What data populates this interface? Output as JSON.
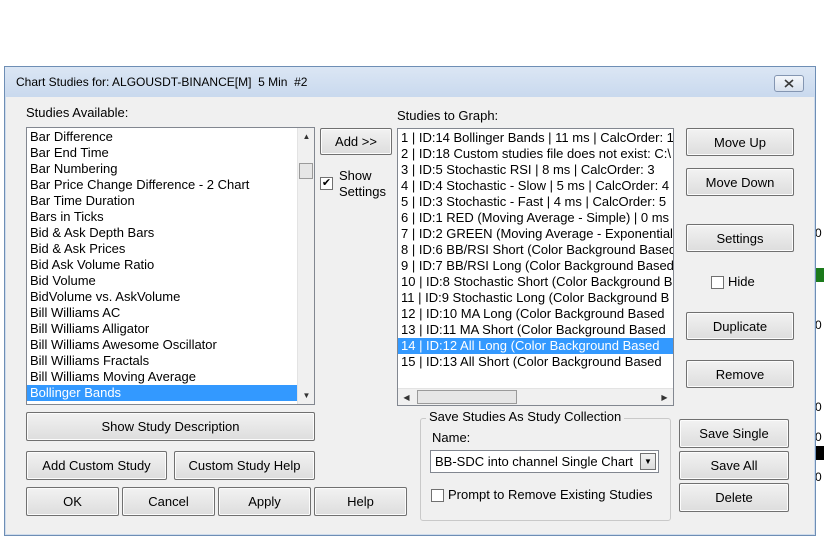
{
  "background_ticks": [
    "0",
    "0",
    "0",
    "0",
    "0"
  ],
  "dialog": {
    "title": "Chart Studies for: ALGOUSDT-BINANCE[M]  5 Min  #2",
    "close_icon": "close-icon"
  },
  "available": {
    "label": "Studies Available:",
    "items": [
      "Bar Difference",
      "Bar End Time",
      "Bar Numbering",
      "Bar Price Change Difference - 2 Chart",
      "Bar Time Duration",
      "Bars in Ticks",
      "Bid & Ask Depth Bars",
      "Bid & Ask Prices",
      "Bid Ask Volume Ratio",
      "Bid Volume",
      "BidVolume vs. AskVolume",
      "Bill Williams AC",
      "Bill Williams Alligator",
      "Bill Williams Awesome Oscillator",
      "Bill Williams Fractals",
      "Bill Williams Moving Average",
      "Bollinger Bands"
    ],
    "selected": "Bollinger Bands"
  },
  "middle": {
    "add_label": "Add >>",
    "show_settings_line1": "Show",
    "show_settings_line2": "Settings",
    "show_settings_checked": true
  },
  "graph": {
    "label": "Studies to Graph:",
    "items": [
      "1 | ID:14  Bollinger Bands | 11 ms | CalcOrder: 1",
      "2 | ID:18  Custom studies file does not exist: C:\\",
      "3 | ID:5  Stochastic RSI | 8 ms | CalcOrder: 3",
      "4 | ID:4  Stochastic - Slow | 5 ms | CalcOrder: 4",
      "5 | ID:3  Stochastic - Fast | 4 ms | CalcOrder: 5",
      "6 | ID:1  RED (Moving Average - Simple) | 0 ms",
      "7 | ID:2  GREEN (Moving Average - Exponential",
      "8 | ID:6  BB/RSI Short (Color Background Based",
      "9 | ID:7  BB/RSI Long (Color Background Based",
      "10 | ID:8  Stochastic Short (Color Background B",
      "11 | ID:9  Stochastic Long (Color Background B",
      "12 | ID:10  MA Long (Color Background Based",
      "13 | ID:11  MA Short (Color Background Based",
      "14 | ID:12  All Long (Color Background Based",
      "15 | ID:13  All Short (Color Background Based"
    ],
    "selected": "14 | ID:12  All Long (Color Background Based"
  },
  "right_buttons": {
    "move_up": "Move Up",
    "move_down": "Move Down",
    "settings": "Settings",
    "hide": "Hide",
    "duplicate": "Duplicate",
    "remove": "Remove"
  },
  "bottom_left": {
    "show_description": "Show Study Description",
    "add_custom": "Add Custom Study",
    "custom_help": "Custom Study Help",
    "ok": "OK",
    "cancel": "Cancel",
    "apply": "Apply",
    "help": "Help"
  },
  "collection": {
    "group_title": "Save Studies As Study Collection",
    "name_label": "Name:",
    "name_value": "BB-SDC into channel Single Chart",
    "prompt_label": "Prompt to Remove Existing Studies",
    "prompt_checked": false,
    "save_single": "Save Single",
    "save_all": "Save All",
    "delete": "Delete"
  }
}
